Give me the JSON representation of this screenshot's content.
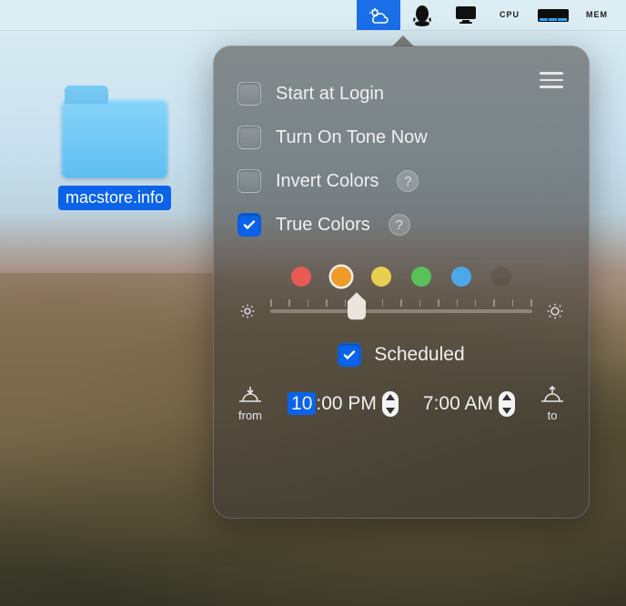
{
  "desktop": {
    "folder_label": "macstore.info"
  },
  "menubar": {
    "items": [
      "weather-icon",
      "qq-icon",
      "imac-icon",
      "cpu-widget",
      "disk-widget",
      "mem-widget"
    ],
    "cpu_label": "CPU",
    "mem_label": "MEM"
  },
  "popover": {
    "options": [
      {
        "key": "start_login",
        "label": "Start at Login",
        "checked": false,
        "help": false
      },
      {
        "key": "tone_now",
        "label": "Turn On Tone Now",
        "checked": false,
        "help": false
      },
      {
        "key": "invert",
        "label": "Invert Colors",
        "checked": false,
        "help": true
      },
      {
        "key": "true_colors",
        "label": "True Colors",
        "checked": true,
        "help": true
      }
    ],
    "help_glyph": "?",
    "colors": [
      {
        "name": "red",
        "hex": "#e85a52",
        "selected": false
      },
      {
        "name": "orange",
        "hex": "#f09a2a",
        "selected": true
      },
      {
        "name": "yellow",
        "hex": "#e9cf4f",
        "selected": false
      },
      {
        "name": "green",
        "hex": "#58c258",
        "selected": false
      },
      {
        "name": "blue",
        "hex": "#4aa9e8",
        "selected": false
      },
      {
        "name": "dark",
        "hex": "#2a2a2a",
        "selected": false,
        "dim": true
      }
    ],
    "slider": {
      "ticks": 15,
      "value_pct": 33
    },
    "scheduled": {
      "label": "Scheduled",
      "checked": true
    },
    "schedule": {
      "from_label": "from",
      "to_label": "to",
      "from_time": {
        "selected_part": "10",
        "rest": ":00 PM"
      },
      "to_time": {
        "full": "7:00 AM"
      }
    }
  }
}
